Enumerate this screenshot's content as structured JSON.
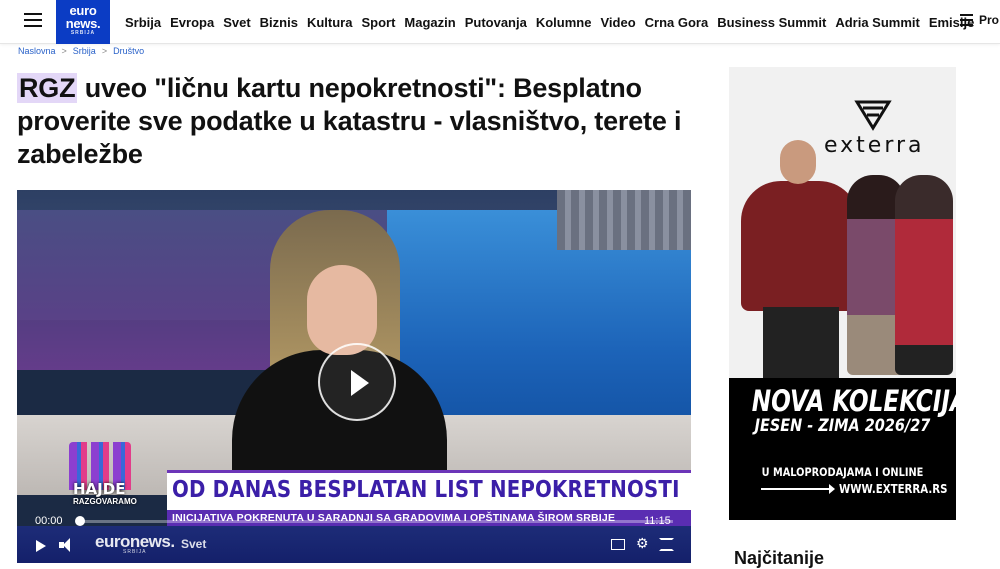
{
  "header": {
    "logo_line1": "euro",
    "logo_line2": "news.",
    "logo_line3": "SRBIJA",
    "nav": [
      "Srbija",
      "Evropa",
      "Svet",
      "Biznis",
      "Kultura",
      "Sport",
      "Magazin",
      "Putovanja",
      "Kolumne",
      "Video",
      "Crna Gora",
      "Business Summit",
      "Adria Summit",
      "Emisije"
    ],
    "more_label": "Pro"
  },
  "breadcrumb": [
    "Naslovna",
    "Srbija",
    "Društvo"
  ],
  "article": {
    "title_highlight": "RGZ",
    "title_rest": " uveo \"ličnu kartu nepokretnosti\": Besplatno proverite sve podatke u katastru - vlasništvo, terete i zabeležbe"
  },
  "video": {
    "show_name": "HAJDE",
    "show_name2": "RAZGOVARAMO",
    "lower_third_title": "OD DANAS BESPLATAN LIST NEPOKRETNOSTI",
    "lower_third_sub": "INICIJATIVA POKRENUTA U SARADNJI SA GRADOVIMA I OPŠTINAMA ŠIROM SRBIJE",
    "current_time": "00:00",
    "total_time": "11:15",
    "progress": 0,
    "brand": "euronews.",
    "brand_sub": "SRBIJA",
    "tag": "Svet"
  },
  "ad": {
    "brand": "exterra",
    "headline": "NOVA KOLEKCIJA",
    "season": "JESEN - ZIMA 2026/27",
    "retail": "U MALOPRODAJAMA I ONLINE",
    "url": "WWW.EXTERRA.RS"
  },
  "sidebar": {
    "most_read": "Najčitanije"
  },
  "colors": {
    "logo_bg": "#0b3cc4",
    "link": "#2a62c9",
    "title_highlight": "#e3d7f7",
    "lower_third_accent": "#5a2db2"
  }
}
